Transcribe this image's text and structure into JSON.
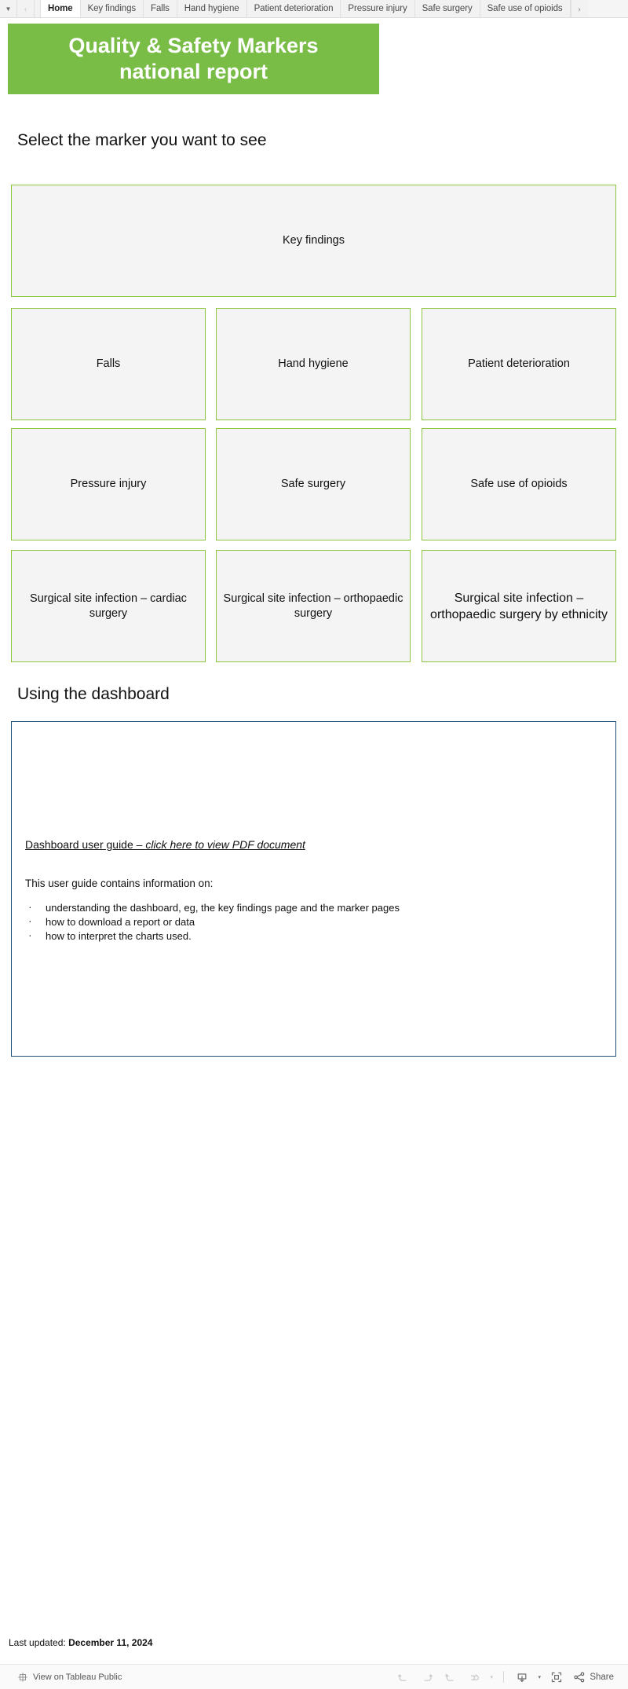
{
  "tabbar": {
    "menu_caret": "▼",
    "prev_label": "‹",
    "next_label": "›",
    "tabs": [
      {
        "label": "Home",
        "active": true
      },
      {
        "label": "Key findings",
        "active": false
      },
      {
        "label": "Falls",
        "active": false
      },
      {
        "label": "Hand hygiene",
        "active": false
      },
      {
        "label": "Patient deterioration",
        "active": false
      },
      {
        "label": "Pressure injury",
        "active": false
      },
      {
        "label": "Safe surgery",
        "active": false
      },
      {
        "label": "Safe use of opioids",
        "active": false
      }
    ]
  },
  "banner": {
    "line1": "Quality & Safety Markers",
    "line2": "national report",
    "background_color": "#79bd47",
    "text_color": "#ffffff"
  },
  "headings": {
    "select_marker": "Select the marker you want to see",
    "using_dashboard": "Using the dashboard"
  },
  "markers": {
    "border_color": "#8cc63f",
    "fill_color": "#f4f4f4",
    "key_findings": "Key findings",
    "falls": "Falls",
    "hand_hygiene": "Hand hygiene",
    "patient_deterioration": "Patient deterioration",
    "pressure_injury": "Pressure injury",
    "safe_surgery": "Safe surgery",
    "safe_use_of_opioids": "Safe use of opioids",
    "ssi_cardiac": "Surgical site infection – cardiac surgery",
    "ssi_orthopaedic": "Surgical site infection – orthopaedic surgery",
    "ssi_orthopaedic_ethnicity": "Surgical site infection – orthopaedic surgery by ethnicity"
  },
  "guide": {
    "border_color": "#1f4e79",
    "link_prefix": "Dashboard user guide – ",
    "link_italic": "click here to view PDF document",
    "intro": "This user guide contains information on:",
    "bullets": [
      "understanding the dashboard, eg, the key findings page and the marker pages",
      "how to download a report or data",
      "how to interpret the charts used."
    ]
  },
  "footer": {
    "last_updated_label": "Last updated: ",
    "last_updated_value": "December 11, 2024"
  },
  "tableau": {
    "view_on_label": "View on Tableau Public",
    "share_label": "Share",
    "undo_label": "Undo",
    "redo_label": "Redo",
    "revert_label": "Revert",
    "refresh_label": "Refresh",
    "pause_label": "Pause",
    "download_label": "Download",
    "fullscreen_label": "Full Screen",
    "caret": "▾"
  }
}
